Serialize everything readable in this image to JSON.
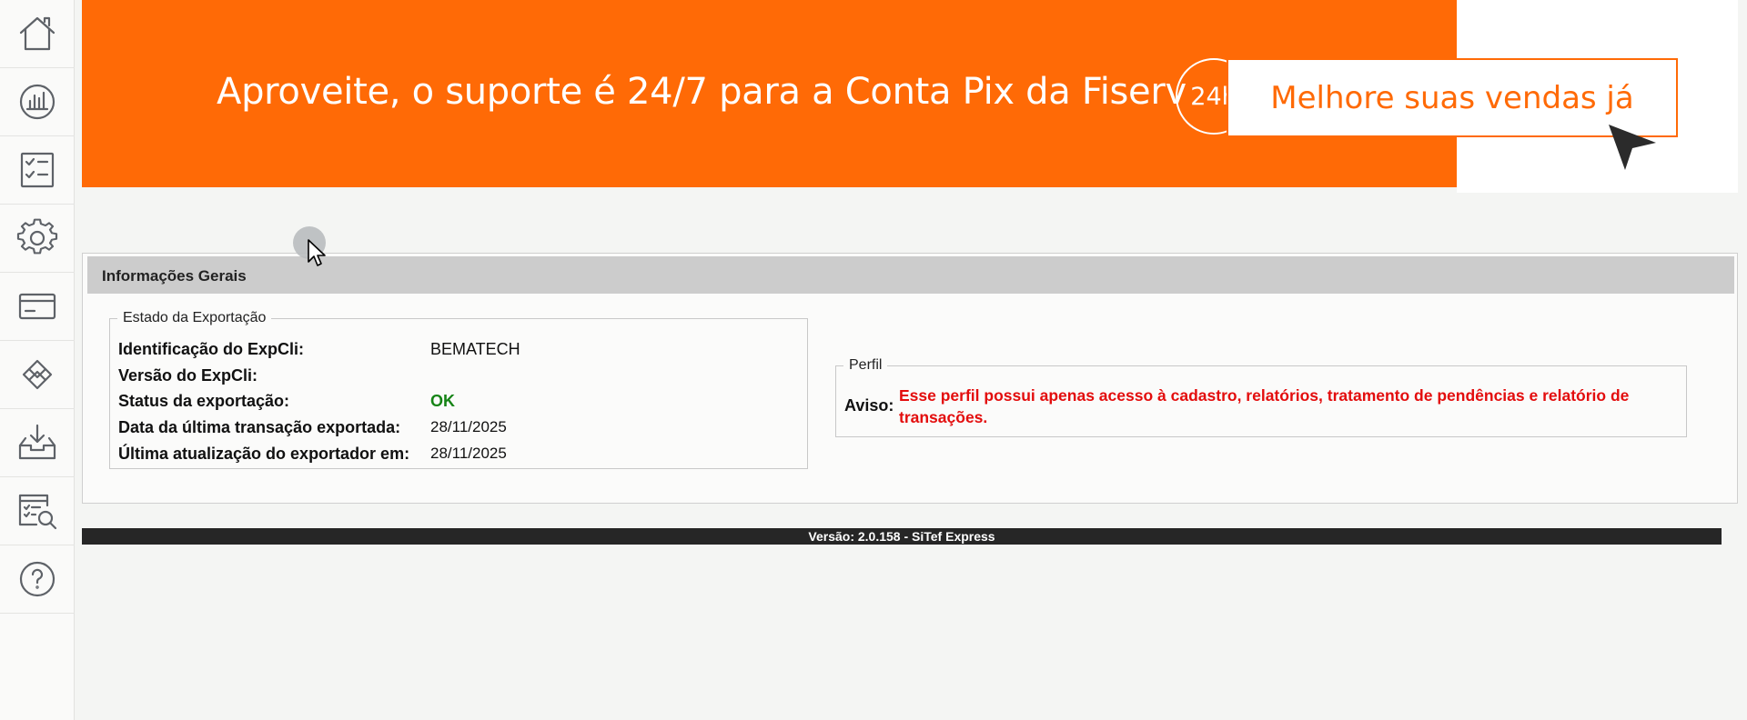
{
  "sidebar": {
    "items": [
      {
        "icon": "home-icon"
      },
      {
        "icon": "bar-chart-icon"
      },
      {
        "icon": "checklist-icon"
      },
      {
        "icon": "gear-icon"
      },
      {
        "icon": "card-icon"
      },
      {
        "icon": "pix-icon"
      },
      {
        "icon": "download-tray-icon"
      },
      {
        "icon": "report-search-icon"
      },
      {
        "icon": "help-icon"
      }
    ]
  },
  "banner": {
    "headline": "Aproveite, o suporte é 24/7 para a Conta Pix da Fiserv",
    "badge": "24h",
    "cta": "Melhore suas vendas já",
    "color": "#ff6a06"
  },
  "panel": {
    "title": "Informações Gerais",
    "export_state": {
      "legend": "Estado da Exportação",
      "rows": [
        {
          "label": "Identificação do ExpCli:",
          "value": "BEMATECH"
        },
        {
          "label": "Versão do ExpCli:",
          "value": ""
        },
        {
          "label": "Status da exportação:",
          "value": "OK"
        },
        {
          "label": "Data da última transação exportada:",
          "value": "28/11/2025"
        },
        {
          "label": "Última atualização do exportador em:",
          "value": "28/11/2025"
        }
      ]
    },
    "profile": {
      "legend": "Perfil",
      "warning_label": "Aviso:",
      "warning_text": "Esse perfil possui apenas acesso à cadastro, relatórios, tratamento de pendências e relatório de transações."
    }
  },
  "footer": {
    "version": "Versão: 2.0.158 - SiTef Express"
  }
}
